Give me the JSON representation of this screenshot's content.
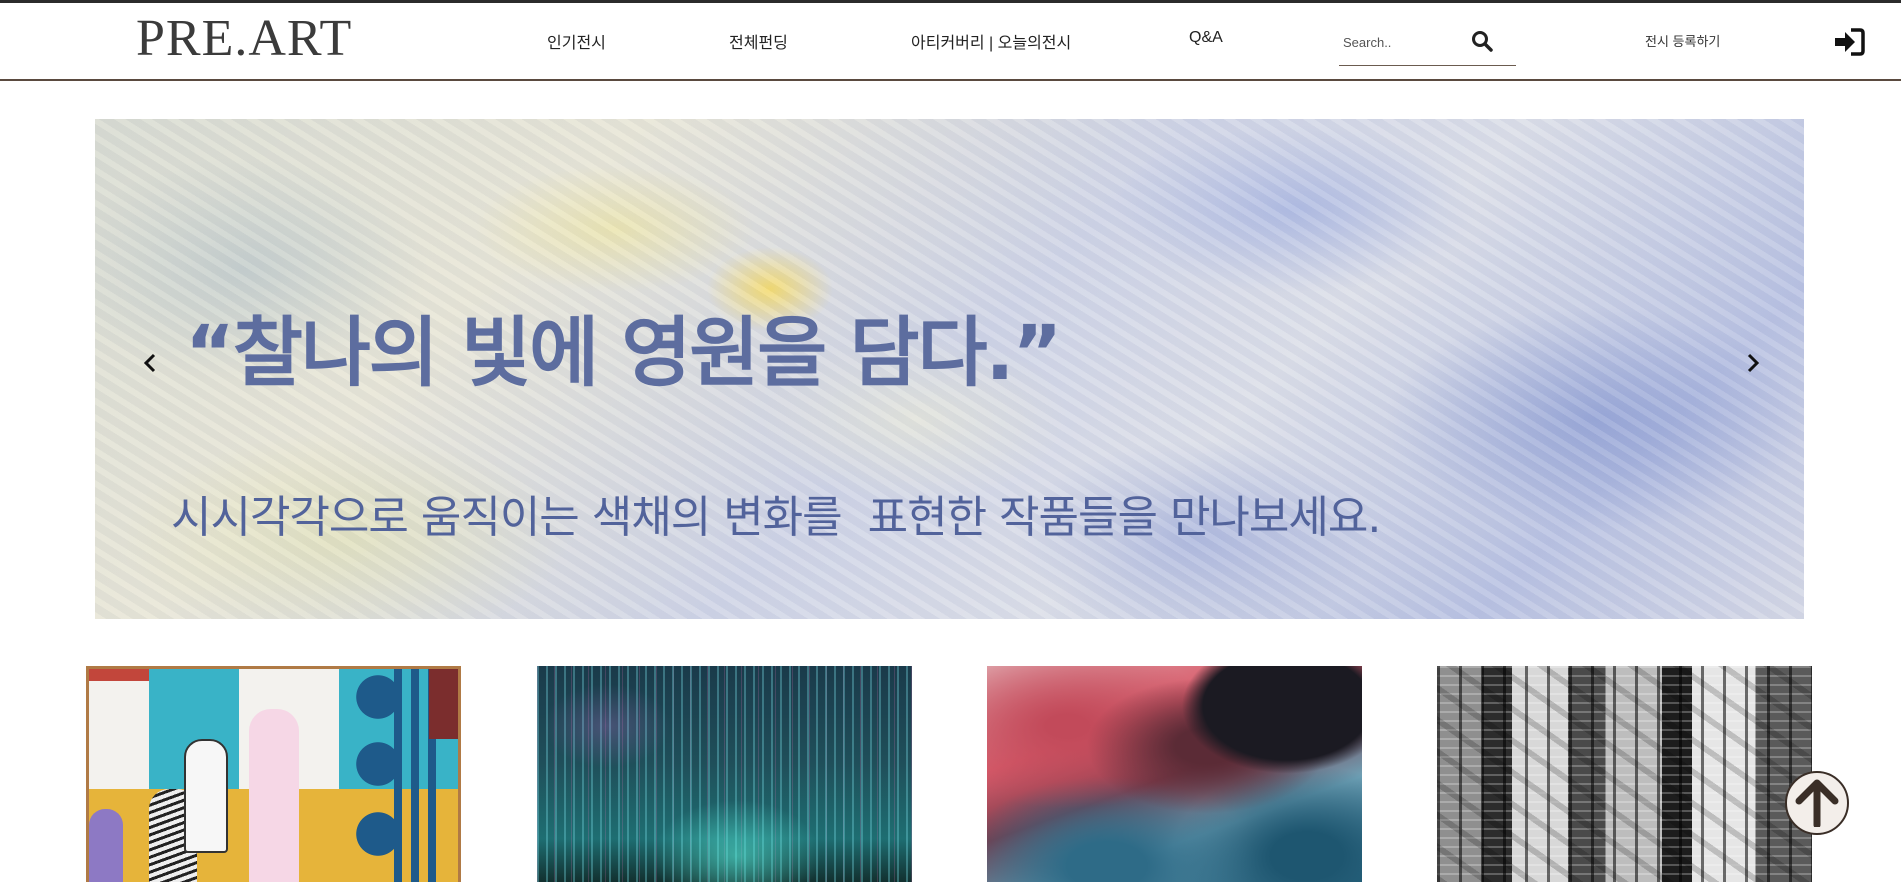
{
  "header": {
    "logo": "PRE.ART",
    "nav": [
      {
        "label": "인기전시"
      },
      {
        "label": "전체펀딩"
      },
      {
        "label": "아티커버리 | 오늘의전시"
      },
      {
        "label": "Q&A"
      }
    ],
    "search": {
      "placeholder": "Search.."
    },
    "register_label": "전시 등록하기"
  },
  "banner": {
    "quote": "“찰나의 빛에 영원을 담다.”",
    "subtitle": "시시각각으로 움직이는 색채의 변화를  표현한 작품들을 만나보세요."
  },
  "cards": [
    {
      "icon": "collage-artwork-image"
    },
    {
      "icon": "light-installation-image"
    },
    {
      "icon": "fluid-paint-image"
    },
    {
      "icon": "city-aerial-image"
    }
  ],
  "colors": {
    "brand_dark": "#3b3b3b",
    "header_border": "#5a4a3f",
    "banner_text": "#5d6d9f"
  }
}
